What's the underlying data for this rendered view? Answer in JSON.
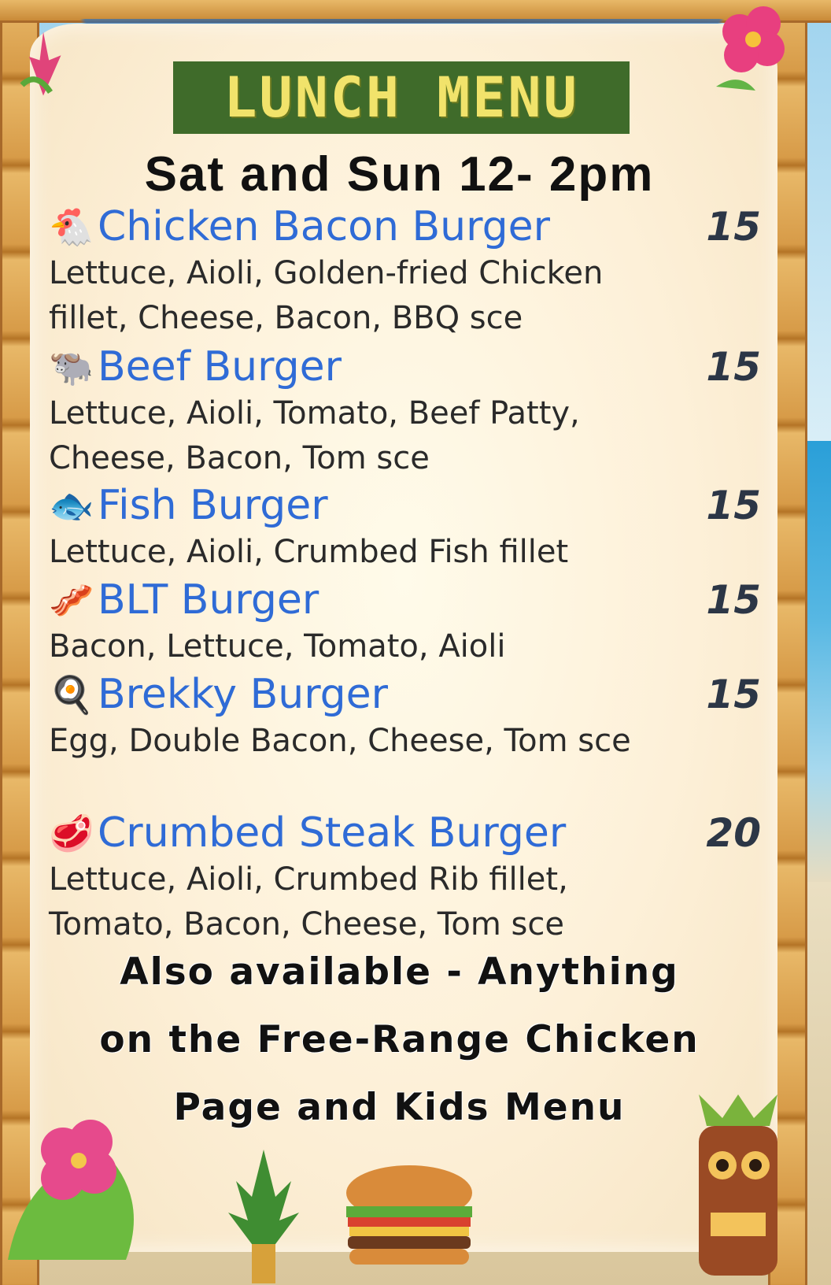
{
  "title": "LUNCH MENU",
  "subtitle": "Sat and Sun 12- 2pm",
  "items": [
    {
      "icon": "🐔",
      "icon_name": "chicken-icon",
      "name": "Chicken Bacon Burger",
      "price": "15",
      "desc": "Lettuce, Aioli, Golden-fried Chicken fillet, Cheese, Bacon, BBQ sce"
    },
    {
      "icon": "🐃",
      "icon_name": "bull-icon",
      "name": "Beef Burger",
      "price": "15",
      "desc": "Lettuce, Aioli, Tomato, Beef Patty, Cheese, Bacon, Tom sce"
    },
    {
      "icon": "🐟",
      "icon_name": "fish-icon",
      "name": "Fish Burger",
      "price": "15",
      "desc": "Lettuce, Aioli, Crumbed Fish fillet"
    },
    {
      "icon": "🥓",
      "icon_name": "bacon-icon",
      "name": "BLT Burger",
      "price": "15",
      "desc": "Bacon, Lettuce, Tomato, Aioli"
    },
    {
      "icon": "🍳",
      "icon_name": "fried-egg-icon",
      "name": "Brekky Burger",
      "price": "15",
      "desc": "Egg, Double Bacon, Cheese, Tom sce"
    },
    {
      "icon": "🥩",
      "icon_name": "steak-icon",
      "name": "Crumbed Steak Burger",
      "price": "20",
      "desc": "Lettuce, Aioli, Crumbed Rib fillet, Tomato, Bacon, Cheese, Tom sce"
    }
  ],
  "footer": {
    "line1": "Also available - Anything",
    "line2": "on the Free-Range Chicken",
    "line3": "Page and Kids Menu"
  },
  "colors": {
    "title_bg": "#3f6b2a",
    "title_text": "#f1e36b",
    "item_name": "#2f6bd6",
    "price": "#2c3646"
  }
}
